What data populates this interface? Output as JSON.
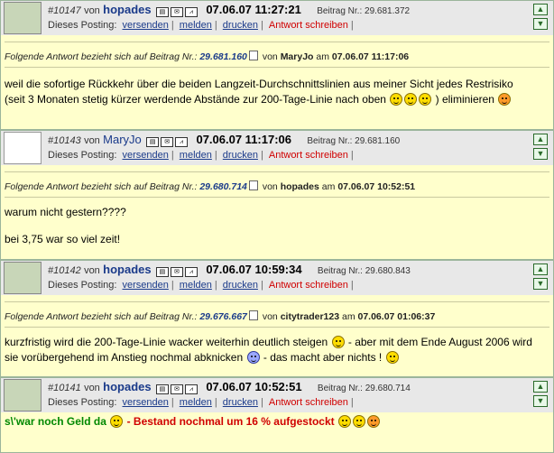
{
  "common": {
    "von": "von",
    "beitrag_label": "Beitrag Nr.:",
    "dieses_posting": "Dieses Posting:",
    "versenden": "versenden",
    "melden": "melden",
    "drucken": "drucken",
    "antwort": "Antwort schreiben",
    "ref_prefix": "Folgende Antwort bezieht sich auf Beitrag Nr.:",
    "ref_am": "am"
  },
  "posts": [
    {
      "num": "#10147",
      "user": "hopades",
      "date": "07.06.07 11:27:21",
      "beitrag_nr": "29.681.372",
      "ref_nr": "29.681.160",
      "ref_user": "MaryJo",
      "ref_date": "07.06.07 11:17:06",
      "text1": "weil die sofortige Rückkehr über die beiden Langzeit-Durchschnittslinien aus meiner Sicht jedes Restrisiko",
      "text2": "(seit 3 Monaten stetig kürzer werdende Abstände zur 200-Tage-Linie nach oben",
      "text3": ") eliminieren"
    },
    {
      "num": "#10143",
      "user": "MaryJo",
      "date": "07.06.07 11:17:06",
      "beitrag_nr": "29.681.160",
      "ref_nr": "29.680.714",
      "ref_user": "hopades",
      "ref_date": "07.06.07 10:52:51",
      "text1": "warum nicht gestern????",
      "text2": "bei 3,75 war so viel zeit!"
    },
    {
      "num": "#10142",
      "user": "hopades",
      "date": "07.06.07 10:59:34",
      "beitrag_nr": "29.680.843",
      "ref_nr": "29.676.667",
      "ref_user": "citytrader123",
      "ref_date": "07.06.07 01:06:37",
      "text1a": "kurzfristig wird die 200-Tage-Linie wacker weiterhin deutlich steigen",
      "text1b": "- aber mit dem Ende August 2006 wird",
      "text2a": "sie vorübergehend im Anstieg nochmal abknicken",
      "text2b": "- das macht aber nichts !"
    },
    {
      "num": "#10141",
      "user": "hopades",
      "date": "07.06.07 10:52:51",
      "beitrag_nr": "29.680.714",
      "text_green": "s\\'war noch Geld da",
      "text_red": "- Bestand nochmal um 16 % aufgestockt"
    }
  ]
}
